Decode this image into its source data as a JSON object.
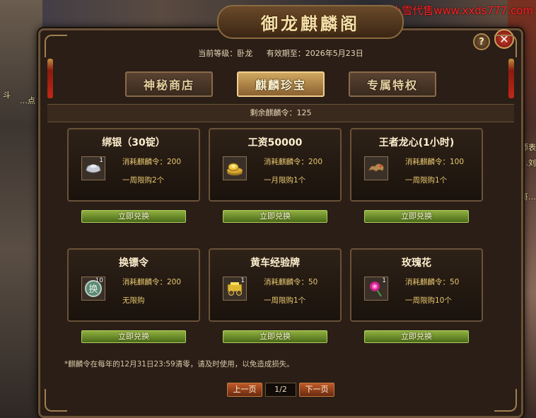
{
  "watermark": "小雪代售www.xxds777.com",
  "side_texts": [
    "斗",
    "…点",
    "师表",
    "…刘",
    "哥…"
  ],
  "window": {
    "title": "御龙麒麟阁",
    "help_label": "?",
    "close_label": "✕"
  },
  "info": {
    "level_label": "当前等级：卧龙",
    "expiry_label": "有效期至：2026年5月23日"
  },
  "tabs": [
    {
      "label": "神秘商店",
      "active": false
    },
    {
      "label": "麒麟珍宝",
      "active": true
    },
    {
      "label": "专属特权",
      "active": false
    }
  ],
  "remaining": "剩余麒麟令：125",
  "items": [
    {
      "title": "绑银（30锭）",
      "icon": "silver-ingot-icon",
      "count": "1",
      "cost": "消耗麒麟令：200",
      "limit": "一周限购2个",
      "button": "立即兑换"
    },
    {
      "title": "工资50000",
      "icon": "gold-coins-icon",
      "count": "",
      "cost": "消耗麒麟令：200",
      "limit": "一月限购1个",
      "button": "立即兑换"
    },
    {
      "title": "王者龙心(1小时)",
      "icon": "dragon-heart-icon",
      "count": "",
      "cost": "消耗麒麟令：100",
      "limit": "一周限购1个",
      "button": "立即兑换"
    },
    {
      "title": "换镖令",
      "icon": "escort-token-icon",
      "count": "10",
      "cost": "消耗麒麟令：200",
      "limit": "无限购",
      "button": "立即兑换"
    },
    {
      "title": "黄车经验牌",
      "icon": "yellow-cart-icon",
      "count": "1",
      "cost": "消耗麒麟令：50",
      "limit": "一周限购1个",
      "button": "立即兑换"
    },
    {
      "title": "玫瑰花",
      "icon": "rose-icon",
      "count": "1",
      "cost": "消耗麒麟令：50",
      "limit": "一周限购10个",
      "button": "立即兑换"
    }
  ],
  "notice": "*麒麟令在每年的12月31日23:59清零，请及时使用，以免造成损失。",
  "pager": {
    "prev": "上一页",
    "page": "1/2",
    "next": "下一页"
  }
}
